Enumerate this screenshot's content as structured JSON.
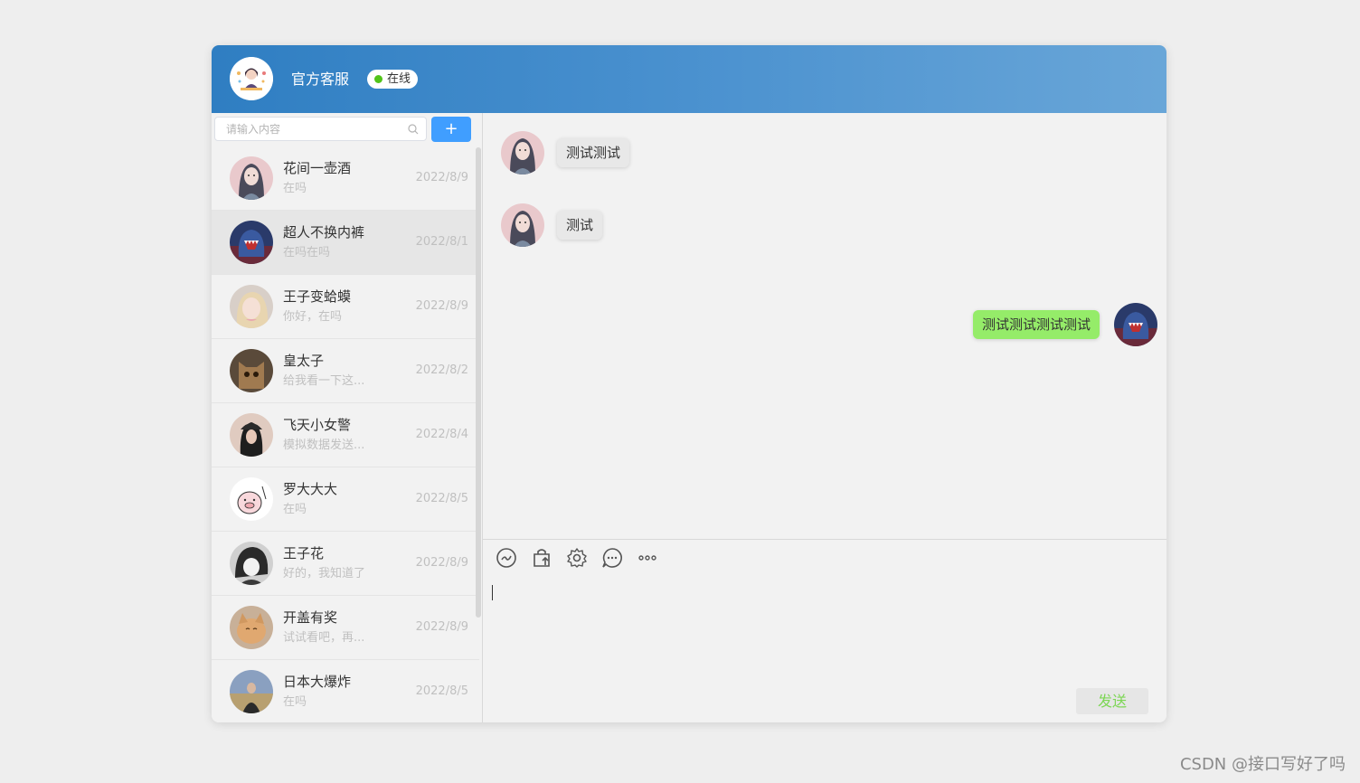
{
  "header": {
    "title": "官方客服",
    "status": "在线",
    "avatar_icon": "customer-service-avatar"
  },
  "search": {
    "placeholder": "请输入内容",
    "add_label": "+"
  },
  "contacts": [
    {
      "name": "花间一壶酒",
      "msg": "在吗",
      "date": "2022/8/9",
      "avatar": "girl-portrait",
      "active": false
    },
    {
      "name": "超人不换内裤",
      "msg": "在吗在吗",
      "date": "2022/8/1",
      "avatar": "shark-monster",
      "active": true
    },
    {
      "name": "王子变蛤蟆",
      "msg": "你好，在吗",
      "date": "2022/8/9",
      "avatar": "blonde-girl",
      "active": false
    },
    {
      "name": "皇太子",
      "msg": "给我看一下这...",
      "date": "2022/8/2",
      "avatar": "cat-face",
      "active": false
    },
    {
      "name": "飞天小女警",
      "msg": "模拟数据发送...",
      "date": "2022/8/4",
      "avatar": "girl-hat",
      "active": false
    },
    {
      "name": "罗大大大",
      "msg": "在吗",
      "date": "2022/8/5",
      "avatar": "cartoon-pig",
      "active": false
    },
    {
      "name": "王子花",
      "msg": "好的，我知道了",
      "date": "2022/8/9",
      "avatar": "anime-boy",
      "active": false
    },
    {
      "name": "开盖有奖",
      "msg": "试试看吧，再...",
      "date": "2022/8/9",
      "avatar": "orange-cat",
      "active": false
    },
    {
      "name": "日本大爆炸",
      "msg": "在吗",
      "date": "2022/8/5",
      "avatar": "man-outdoor",
      "active": false
    }
  ],
  "messages": [
    {
      "side": "left",
      "text": "测试测试"
    },
    {
      "side": "left",
      "text": "测试"
    },
    {
      "side": "right",
      "text": "测试测试测试测试"
    }
  ],
  "toolbar": {
    "icons": [
      "emoji-icon",
      "bag-upload-icon",
      "settings-icon",
      "chat-icon",
      "more-icon"
    ]
  },
  "composer": {
    "value": "",
    "send_label": "发送"
  },
  "colors": {
    "header_start": "#2f7ec2",
    "header_end": "#69a6d8",
    "online": "#52c41a",
    "bubble_self": "#95ec69",
    "primary": "#409eff"
  },
  "watermark": "CSDN @接口写好了吗"
}
